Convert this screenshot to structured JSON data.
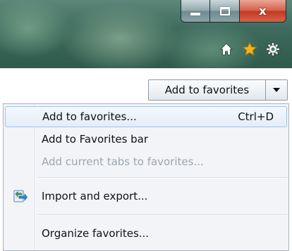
{
  "window": {
    "caption": {
      "minimize_icon": "minimize-icon",
      "maximize_icon": "restore-icon",
      "close_label": "x"
    },
    "toolbar_icons": [
      "home-icon",
      "star-icon",
      "gear-icon"
    ]
  },
  "favorites": {
    "add_button_label": "Add to favorites",
    "dropdown_icon": "chevron-down-icon",
    "menu": {
      "items": [
        {
          "label": "Add to favorites...",
          "shortcut": "Ctrl+D",
          "state": "hover"
        },
        {
          "label": "Add to Favorites bar",
          "state": "enabled"
        },
        {
          "label": "Add current tabs to favorites...",
          "state": "disabled"
        },
        {
          "label": "Import and export...",
          "icon": "import-export-icon",
          "state": "enabled"
        },
        {
          "label": "Organize favorites...",
          "state": "enabled"
        }
      ]
    }
  },
  "colors": {
    "close_red": "#c23a22",
    "star_gold": "#f2b51c",
    "menu_bg": "#f2f4f7",
    "hover_border": "#a6c2e5",
    "disabled_text": "#a0a6ad"
  }
}
